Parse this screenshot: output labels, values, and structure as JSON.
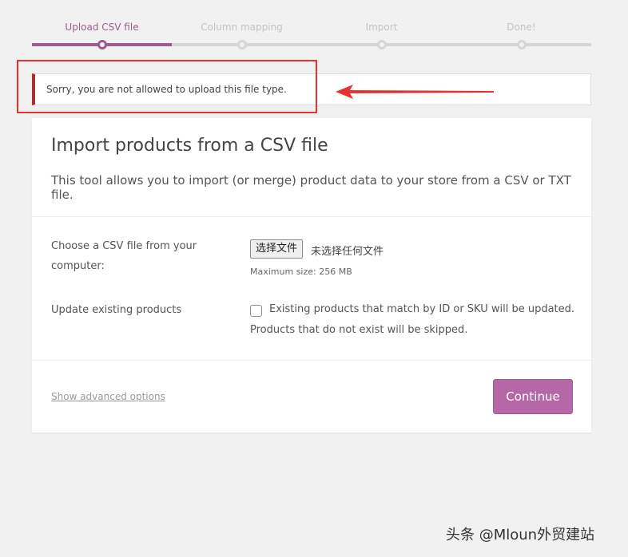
{
  "steps": [
    {
      "label": "Upload CSV file",
      "active": true
    },
    {
      "label": "Column mapping",
      "active": false
    },
    {
      "label": "Import",
      "active": false
    },
    {
      "label": "Done!",
      "active": false
    }
  ],
  "notice": {
    "message": "Sorry, you are not allowed to upload this file type."
  },
  "card": {
    "title": "Import products from a CSV file",
    "description": "This tool allows you to import (or merge) product data to your store from a CSV or TXT file."
  },
  "form": {
    "file_label": "Choose a CSV file from your computer:",
    "file_button": "选择文件",
    "file_status": "未选择任何文件",
    "max_size": "Maximum size: 256 MB",
    "update_label": "Update existing products",
    "update_desc_1": "Existing products that match by ID or SKU will be updated.",
    "update_desc_2": "Products that do not exist will be skipped."
  },
  "footer": {
    "advanced_link": "Show advanced options",
    "continue_label": "Continue"
  },
  "watermark": "头条 @Mloun外贸建站",
  "colors": {
    "accent": "#9b5c8f",
    "error": "#b12c2c",
    "button": "#b567a8"
  }
}
